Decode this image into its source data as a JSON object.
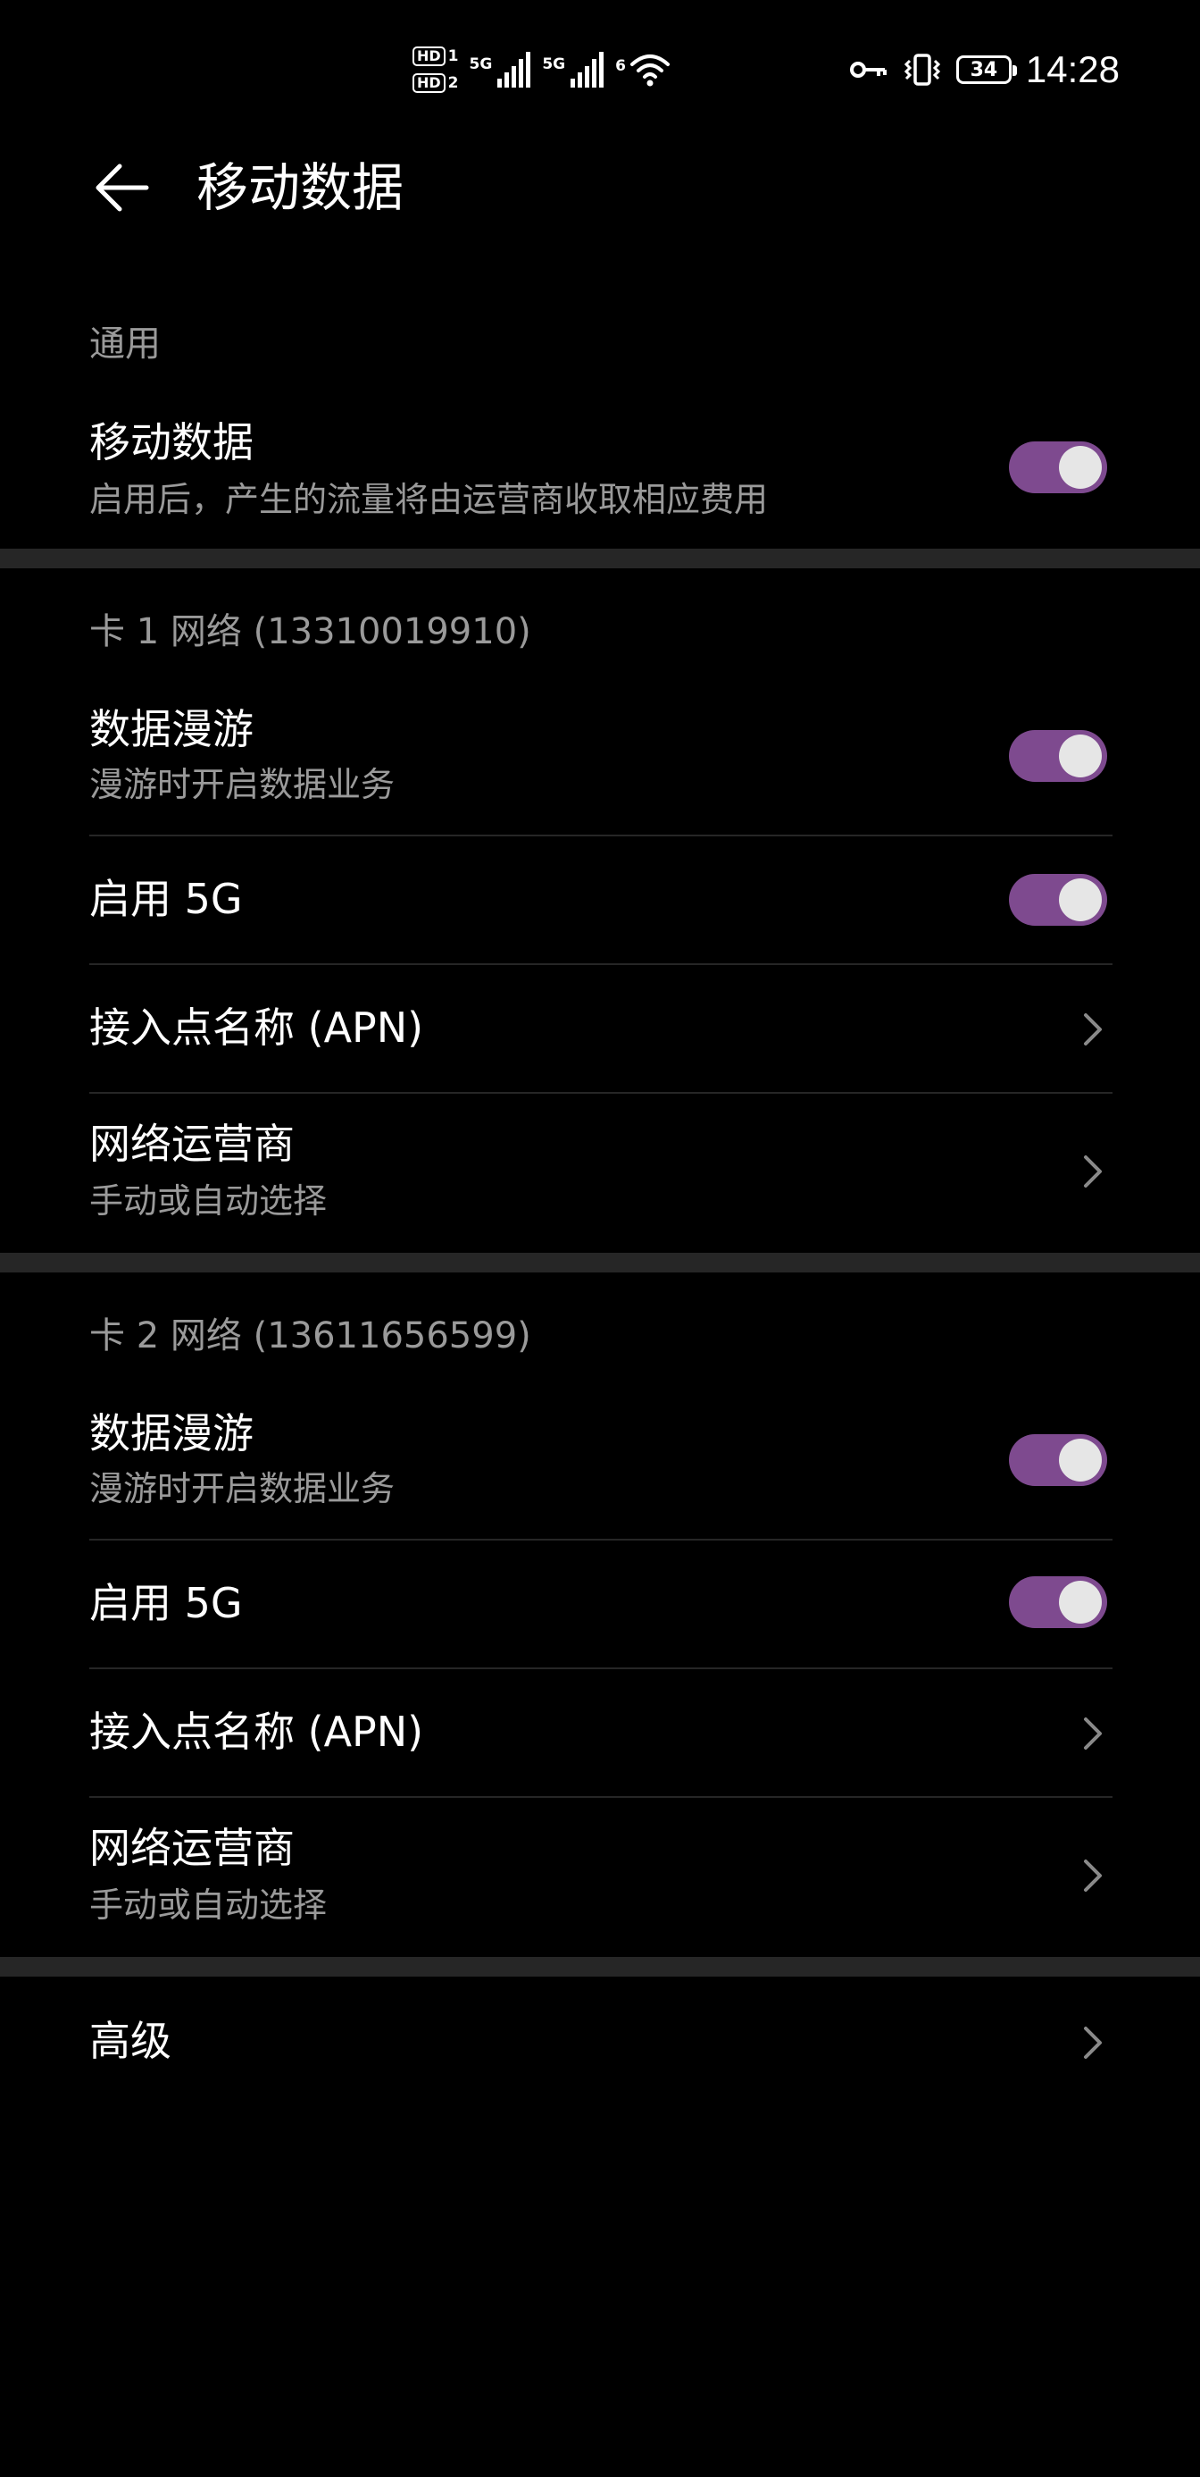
{
  "status_bar": {
    "sim1_badge": "HD",
    "sim1_num": "1",
    "sim2_badge": "HD",
    "sim2_num": "2",
    "net1": "5G",
    "net2": "5G",
    "wifi_label": "6",
    "battery": "34",
    "time": "14:28"
  },
  "header": {
    "title": "移动数据"
  },
  "general": {
    "heading": "通用",
    "mobile_data": {
      "title": "移动数据",
      "subtitle": "启用后，产生的流量将由运营商收取相应费用",
      "on": true
    }
  },
  "card1": {
    "heading": "卡 1 网络 (13310019910)",
    "roaming": {
      "title": "数据漫游",
      "subtitle": "漫游时开启数据业务",
      "on": true
    },
    "enable5g": {
      "title": "启用 5G",
      "on": true
    },
    "apn": {
      "title": "接入点名称 (APN)"
    },
    "operator": {
      "title": "网络运营商",
      "subtitle": "手动或自动选择"
    }
  },
  "card2": {
    "heading": "卡 2 网络 (13611656599)",
    "roaming": {
      "title": "数据漫游",
      "subtitle": "漫游时开启数据业务",
      "on": true
    },
    "enable5g": {
      "title": "启用 5G",
      "on": true
    },
    "apn": {
      "title": "接入点名称 (APN)"
    },
    "operator": {
      "title": "网络运营商",
      "subtitle": "手动或自动选择"
    }
  },
  "advanced": {
    "title": "高级"
  },
  "colors": {
    "background": "#000000",
    "toggle_on": "#7e4a8f",
    "toggle_knob": "#e6e6e6",
    "secondary_text": "#9a9a9a",
    "divider": "#262626"
  }
}
